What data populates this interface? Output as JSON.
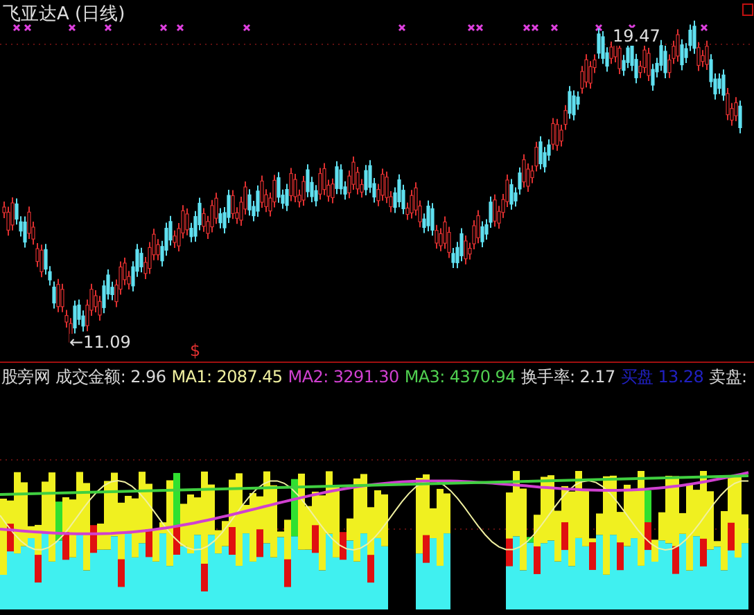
{
  "title": "飞亚达A (日线)",
  "price_labels": {
    "high": "19.47",
    "low": "←11.09",
    "signal": "$"
  },
  "indicator": {
    "name": "股旁网",
    "items": [
      {
        "text": "成交金额: 2.96",
        "color": "#d8d8d8"
      },
      {
        "text": "MA1: 2087.45",
        "color": "#f0f0a0"
      },
      {
        "text": "MA2: 3291.30",
        "color": "#d040d0"
      },
      {
        "text": "MA3: 4370.94",
        "color": "#50d050"
      },
      {
        "text": "换手率: 2.17",
        "color": "#d8d8d8"
      },
      {
        "text": "买盘 13.28",
        "color": "#2020c0"
      },
      {
        "text": "卖盘:",
        "color": "#d8d8d8"
      }
    ]
  }
}
